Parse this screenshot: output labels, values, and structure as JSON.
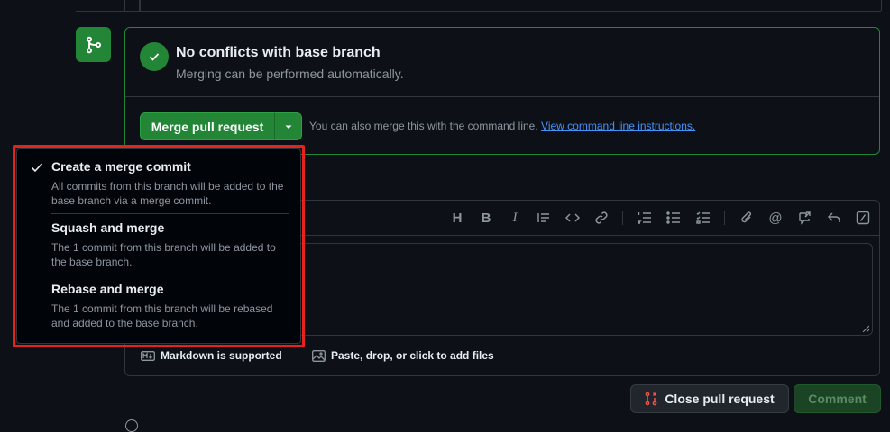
{
  "merge_status": {
    "title": "No conflicts with base branch",
    "subtitle": "Merging can be performed automatically."
  },
  "merge_actions": {
    "merge_button_label": "Merge pull request",
    "cli_hint": "You can also merge this with the command line.",
    "cli_link": "View command line instructions."
  },
  "merge_menu": {
    "items": [
      {
        "title": "Create a merge commit",
        "description": "All commits from this branch will be added to the base branch via a merge commit.",
        "selected": true
      },
      {
        "title": "Squash and merge",
        "description": "The 1 commit from this branch will be added to the base branch.",
        "selected": false
      },
      {
        "title": "Rebase and merge",
        "description": "The 1 commit from this branch will be rebased and added to the base branch.",
        "selected": false
      }
    ]
  },
  "editor": {
    "toolbar_icons": [
      "heading-icon",
      "bold-icon",
      "italic-icon",
      "quote-icon",
      "code-icon",
      "link-icon",
      "numbered-list-icon",
      "unordered-list-icon",
      "task-list-icon",
      "attach-icon",
      "mention-icon",
      "reference-icon",
      "reply-icon",
      "slash-command-icon"
    ],
    "markdown_note": "Markdown is supported",
    "paste_note": "Paste, drop, or click to add files"
  },
  "footer": {
    "close_label": "Close pull request",
    "comment_label": "Comment"
  },
  "colors": {
    "accent_green": "#238636",
    "link_blue": "#4493f8",
    "danger_red": "#f85149",
    "highlight_red": "#e4241c"
  }
}
